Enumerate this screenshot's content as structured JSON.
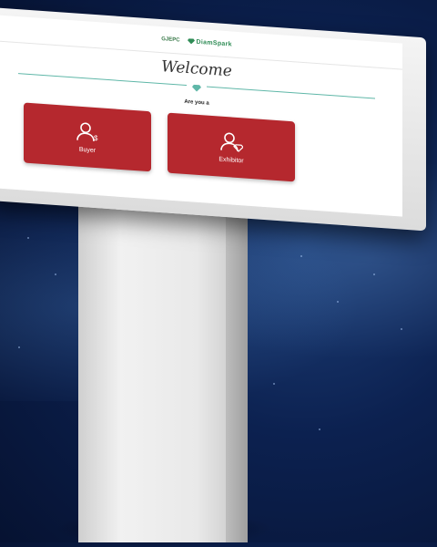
{
  "header": {
    "logo_left": "GJEPC",
    "logo_right": "DiamSpark"
  },
  "screen": {
    "welcome": "Welcome",
    "prompt": "Are you a"
  },
  "choices": [
    {
      "label": "Buyer",
      "icon": "user-dollar-icon"
    },
    {
      "label": "Exhibitor",
      "icon": "user-diamond-icon"
    }
  ],
  "colors": {
    "accent": "#b5282e",
    "teal": "#5fb7a8",
    "background": "#0c2150"
  }
}
